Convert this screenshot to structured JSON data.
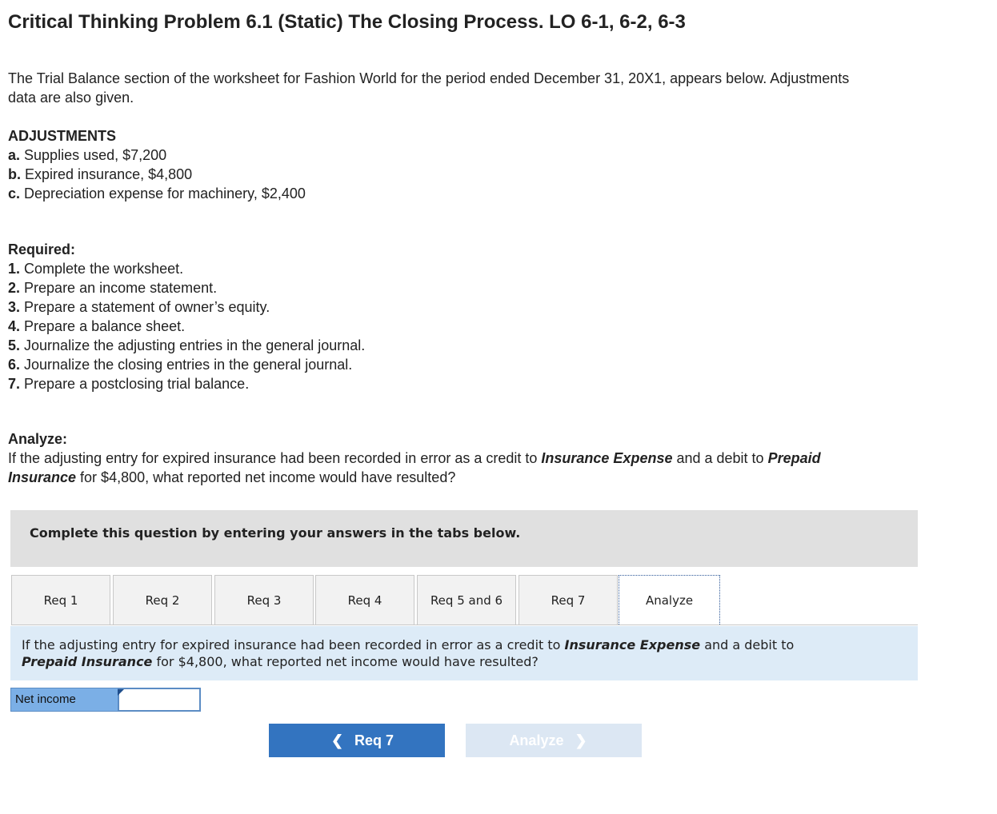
{
  "title": "Critical Thinking Problem 6.1 (Static) The Closing Process. LO 6-1, 6-2, 6-3",
  "intro": {
    "line1": "The Trial Balance section of the worksheet for Fashion World for the period ended December 31, 20X1, appears below. Adjustments",
    "line2": "data are also given."
  },
  "adjustments": {
    "heading": "ADJUSTMENTS",
    "items": [
      {
        "label": "a.",
        "text": "Supplies used, $7,200"
      },
      {
        "label": "b.",
        "text": "Expired insurance, $4,800"
      },
      {
        "label": "c.",
        "text": "Depreciation expense for machinery, $2,400"
      }
    ]
  },
  "required": {
    "heading": "Required:",
    "items": [
      {
        "label": "1.",
        "text": "Complete the worksheet."
      },
      {
        "label": "2.",
        "text": "Prepare an income statement."
      },
      {
        "label": "3.",
        "text": "Prepare a statement of owner’s equity."
      },
      {
        "label": "4.",
        "text": "Prepare a balance sheet."
      },
      {
        "label": "5.",
        "text": "Journalize the adjusting entries in the general journal."
      },
      {
        "label": "6.",
        "text": "Journalize the closing entries in the general journal."
      },
      {
        "label": "7.",
        "text": "Prepare a postclosing trial balance."
      }
    ]
  },
  "analyze": {
    "heading": "Analyze:",
    "part1": "If the adjusting entry for expired insurance had been recorded in error as a credit to ",
    "em1": "Insurance Expense",
    "part2": " and a debit to ",
    "em2a": "Prepaid",
    "em2b": "Insurance",
    "part3": " for $4,800, what reported net income would have resulted?"
  },
  "instruction": "Complete this question by entering your answers in the tabs below.",
  "tabs": [
    {
      "label": "Req 1"
    },
    {
      "label": "Req 2"
    },
    {
      "label": "Req 3"
    },
    {
      "label": "Req 4"
    },
    {
      "label": "Req 5 and 6"
    },
    {
      "label": "Req 7"
    },
    {
      "label": "Analyze",
      "active": true
    }
  ],
  "question": {
    "part1": "If the adjusting entry for expired insurance had been recorded in error as a credit to ",
    "em1": "Insurance Expense",
    "part2": " and a debit to",
    "em2": "Prepaid Insurance",
    "part3": " for $4,800, what reported net income would have resulted?"
  },
  "answer": {
    "label": "Net income",
    "value": ""
  },
  "nav": {
    "prev_label": "Req 7",
    "next_label": "Analyze"
  },
  "colors": {
    "prev_button": "#3374c0",
    "next_button_disabled": "#dce7f3",
    "question_bg": "#ddebf7",
    "label_bg": "#7bafe6"
  }
}
